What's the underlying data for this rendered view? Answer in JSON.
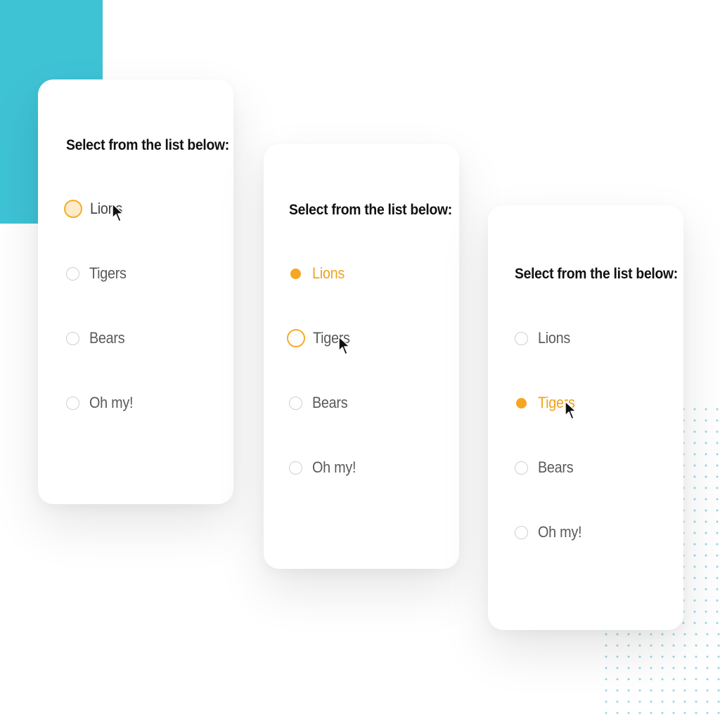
{
  "colors": {
    "accent": "#f5a623",
    "hover_fill": "#fdebc9",
    "teal": "#3ec3d5",
    "dots": "#8fd3e3"
  },
  "cards": [
    {
      "title": "Select from the list below:",
      "options": [
        "Lions",
        "Tigers",
        "Bears",
        "Oh my!"
      ],
      "state": "hovering Lions"
    },
    {
      "title": "Select from the list below:",
      "options": [
        "Lions",
        "Tigers",
        "Bears",
        "Oh my!"
      ],
      "state": "Lions selected, hovering Tigers"
    },
    {
      "title": "Select from the list below:",
      "options": [
        "Lions",
        "Tigers",
        "Bears",
        "Oh my!"
      ],
      "state": "Tigers selected"
    }
  ]
}
